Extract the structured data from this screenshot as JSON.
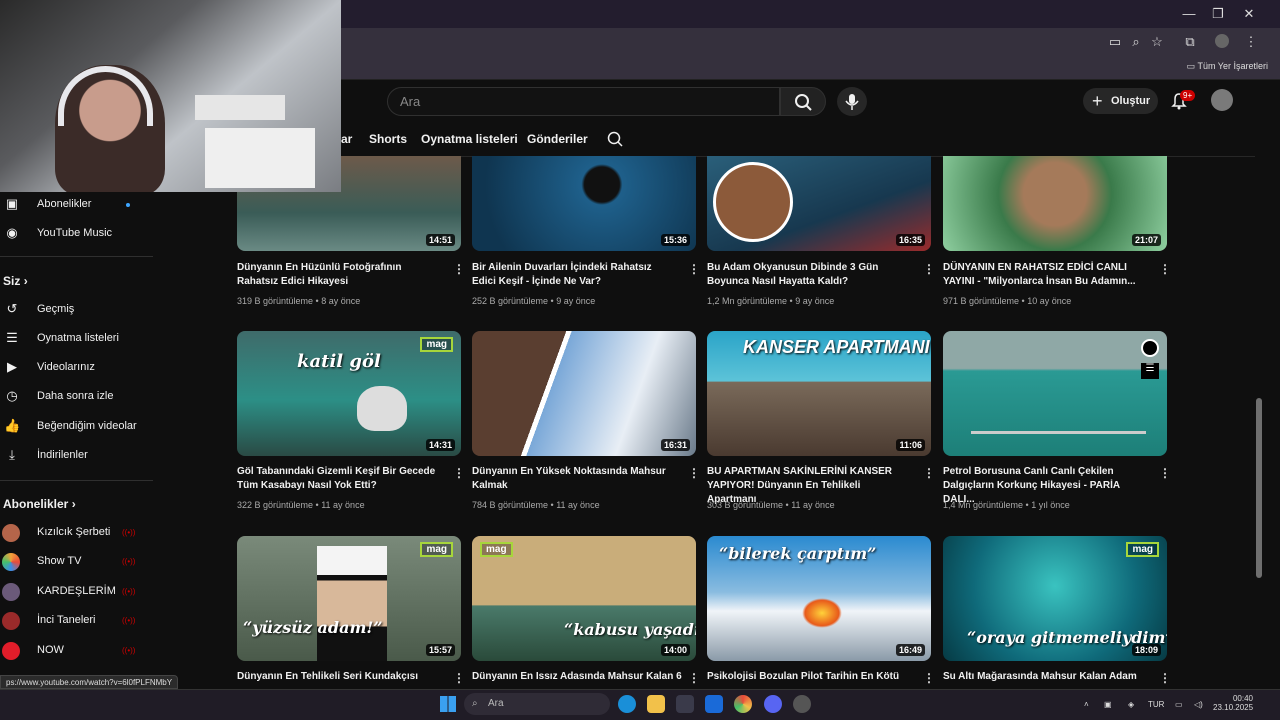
{
  "browser": {
    "bookmarks_label": "Tüm Yer İşaretleri",
    "window_controls": [
      "—",
      "❐",
      "✕"
    ]
  },
  "header": {
    "search_placeholder": "Ara",
    "create_label": "Oluştur",
    "notif_badge": "9+"
  },
  "chips": {
    "items": [
      "ar",
      "Shorts",
      "Oynatma listeleri",
      "Gönderiler"
    ]
  },
  "sidebar": {
    "top_items": [
      {
        "label": "Abonelikler",
        "icon": "subscriptions-icon"
      },
      {
        "label": "YouTube Music",
        "icon": "music-icon"
      }
    ],
    "you_header": "Siz",
    "you_items": [
      {
        "label": "Geçmiş",
        "icon": "history-icon"
      },
      {
        "label": "Oynatma listeleri",
        "icon": "playlists-icon"
      },
      {
        "label": "Videolarınız",
        "icon": "your-videos-icon"
      },
      {
        "label": "Daha sonra izle",
        "icon": "watch-later-icon"
      },
      {
        "label": "Beğendiğim videolar",
        "icon": "liked-icon"
      },
      {
        "label": "İndirilenler",
        "icon": "download-icon"
      }
    ],
    "subs_header": "Abonelikler",
    "subs": [
      {
        "label": "Kızılcık Şerbeti",
        "color": "#b5654a"
      },
      {
        "label": "Show TV",
        "color": "#f2a23a"
      },
      {
        "label": "KARDEŞLERİM",
        "color": "#6b5a7a"
      },
      {
        "label": "İnci Taneleri",
        "color": "#9a2a2a"
      },
      {
        "label": "NOW",
        "color": "#e11d2a"
      }
    ]
  },
  "videos": [
    {
      "title": "Dünyanın En Hüzünlü Fotoğrafının Rahatsız Edici Hikayesi",
      "meta": "319 B görüntüleme • 8 ay önce",
      "duration": "14:51"
    },
    {
      "title": "Bir Ailenin Duvarları İçindeki Rahatsız Edici Keşif - İçinde Ne Var?",
      "meta": "252 B görüntüleme • 9 ay önce",
      "duration": "15:36"
    },
    {
      "title": "Bu Adam Okyanusun Dibinde 3 Gün Boyunca Nasıl Hayatta Kaldı?",
      "meta": "1,2 Mn görüntüleme • 9 ay önce",
      "duration": "16:35"
    },
    {
      "title": "DÜNYANIN EN RAHATSIZ EDİCİ CANLI YAYINI - \"Milyonlarca İnsan Bu Adamın...",
      "meta": "971 B görüntüleme • 10 ay önce",
      "duration": "21:07"
    },
    {
      "title": "Göl Tabanındaki Gizemli Keşif Bir Gecede Tüm Kasabayı Nasıl Yok Etti?",
      "meta": "322 B görüntüleme • 11 ay önce",
      "duration": "14:31",
      "overlay": "katil göl",
      "tag": "mag"
    },
    {
      "title": "Dünyanın En Yüksek Noktasında Mahsur Kalmak",
      "meta": "784 B görüntüleme • 11 ay önce",
      "duration": "16:31"
    },
    {
      "title": "BU APARTMAN SAKİNLERİNİ KANSER YAPIYOR! Dünyanın En Tehlikeli Apartmanı",
      "meta": "303 B görüntüleme • 11 ay önce",
      "duration": "11:06",
      "overlay": "KANSER APARTMANI"
    },
    {
      "title": "Petrol Borusuna Canlı Canlı Çekilen Dalgıçların Korkunç Hikayesi - PARİA DALI...",
      "meta": "1,4 Mn görüntüleme • 1 yıl önce",
      "duration": ""
    },
    {
      "title": "Dünyanın En Tehlikeli Seri Kundakçısı",
      "meta": "",
      "duration": "15:57",
      "overlay": "“yüzsüz adam!”",
      "tag": "mag"
    },
    {
      "title": "Dünyanın En Issız Adasında Mahsur Kalan 6",
      "meta": "",
      "duration": "14:00",
      "overlay": "“kabusu yaşadılar”",
      "tag": "mag"
    },
    {
      "title": "Psikolojisi Bozulan Pilot Tarihin En Kötü",
      "meta": "",
      "duration": "16:49",
      "overlay": "“bilerek çarptım”"
    },
    {
      "title": "Su Altı Mağarasında Mahsur Kalan Adam",
      "meta": "",
      "duration": "18:09",
      "overlay": "“oraya gitmemeliydim”",
      "tag": "mag"
    }
  ],
  "status_url": "ps://www.youtube.com/watch?v=6l0fPLFNMbY",
  "taskbar": {
    "search_label": "Ara",
    "lang": "TUR",
    "time": "00:40",
    "date": "23.10.2025"
  }
}
